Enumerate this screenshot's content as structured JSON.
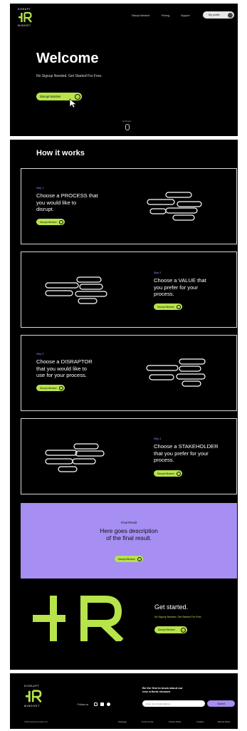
{
  "logo": {
    "top": "DISRUPT",
    "mark": "-|R",
    "bottom": "MINDSET"
  },
  "nav": {
    "items": [
      "Disrupt Mindset",
      "Pricing",
      "Support"
    ],
    "profile_label": "My profile"
  },
  "hero": {
    "title": "Welcome",
    "subtitle": "No Signup Needed. Get Started For Free.",
    "cta": "Disrupt Mindset",
    "scroll_label": "Scroll down"
  },
  "how": {
    "title": "How it works",
    "steps": [
      {
        "label": "Step 1",
        "title": "Choose a PROCESS that\nyou would like to\ndisrupt.",
        "cta": "Disrupt Mindset"
      },
      {
        "label": "Step 2",
        "title": "Choose a VALUE that\nyou prefer for your\nprocess.",
        "cta": "Disrupt Mindset"
      },
      {
        "label": "Step 3",
        "title": "Choose a DISRAPTOR\nthat you would like to\nuse for your process.",
        "cta": "Disrupt Mindset"
      },
      {
        "label": "Step 4",
        "title": "Choose a STAKEHOLDER\nthat you prefer for your\nprocess.",
        "cta": "Disrupt Mindset"
      }
    ]
  },
  "result": {
    "label": "Final Result",
    "description": "Here goes description\nof the final result.",
    "cta": "Disrupt Mindset"
  },
  "get_started": {
    "big_mark": "-|R",
    "title": "Get started.",
    "subtitle": "No Signup Needed. Get Started For Free.",
    "cta": "Disrupt Mindset"
  },
  "footer": {
    "follow_label": "Follow us",
    "newsletter_title": "Be the first to know about our\nnew criteria releases",
    "email_placeholder": "Enter Your Email Address",
    "submit_label": "Submit",
    "copyright": "©2023 disruptmindset.com",
    "links": [
      "FAQpage",
      "Terms of Use",
      "Privacy Policy",
      "Cookies",
      "Refund Policy"
    ]
  },
  "colors": {
    "accent": "#b7e34b",
    "violet": "#a68ef2",
    "step": "#8b9cf7",
    "background": "#000000"
  }
}
